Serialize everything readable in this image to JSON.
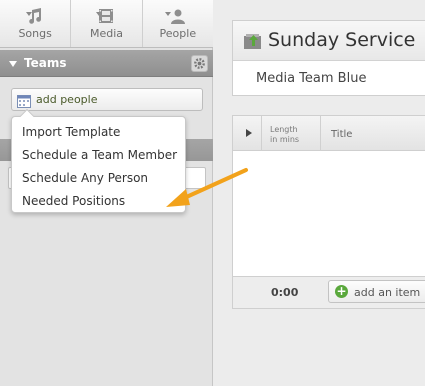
{
  "topnav": {
    "items": [
      {
        "label": "Songs",
        "icon": "music-note-icon"
      },
      {
        "label": "Media",
        "icon": "film-icon"
      },
      {
        "label": "People",
        "icon": "person-icon"
      }
    ]
  },
  "teams": {
    "title": "Teams",
    "add_people_label": "add people"
  },
  "dropdown": {
    "items": [
      {
        "label": "Import Template"
      },
      {
        "label": "Schedule a Team Member"
      },
      {
        "label": "Schedule Any Person"
      },
      {
        "label": "Needed Positions"
      }
    ]
  },
  "plan": {
    "title": "Sunday Service",
    "team": "Media Team Blue"
  },
  "items_table": {
    "length_label_line1": "Length",
    "length_label_line2": "in mins",
    "title_label": "Title",
    "total_time": "0:00",
    "add_item_label": "add an item"
  },
  "colors": {
    "arrow": "#f2a21b",
    "add_green": "#5aa83c",
    "teams_bar": "#999999"
  }
}
